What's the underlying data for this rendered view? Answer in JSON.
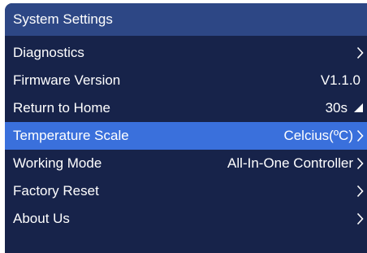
{
  "window": {
    "title": "System Settings"
  },
  "menu": {
    "items": [
      {
        "label": "Diagnostics",
        "value": "",
        "icon": "chevron-right-icon",
        "selected": false
      },
      {
        "label": "Firmware Version",
        "value": "V1.1.0",
        "icon": "",
        "selected": false
      },
      {
        "label": "Return to Home",
        "value": "30s",
        "icon": "corner-triangle-icon",
        "selected": false
      },
      {
        "label": "Temperature Scale",
        "value": "Celcius(ºC)",
        "icon": "chevron-right-icon",
        "selected": true
      },
      {
        "label": "Working Mode",
        "value": "All-In-One Controller",
        "icon": "chevron-right-icon",
        "selected": false
      },
      {
        "label": "Factory Reset",
        "value": "",
        "icon": "chevron-right-icon",
        "selected": false
      },
      {
        "label": "About Us",
        "value": "",
        "icon": "chevron-right-icon",
        "selected": false
      }
    ]
  },
  "colors": {
    "background": "#17234a",
    "title_bar": "#2d4785",
    "selected_row": "#3a70dc",
    "text": "#ffffff"
  }
}
